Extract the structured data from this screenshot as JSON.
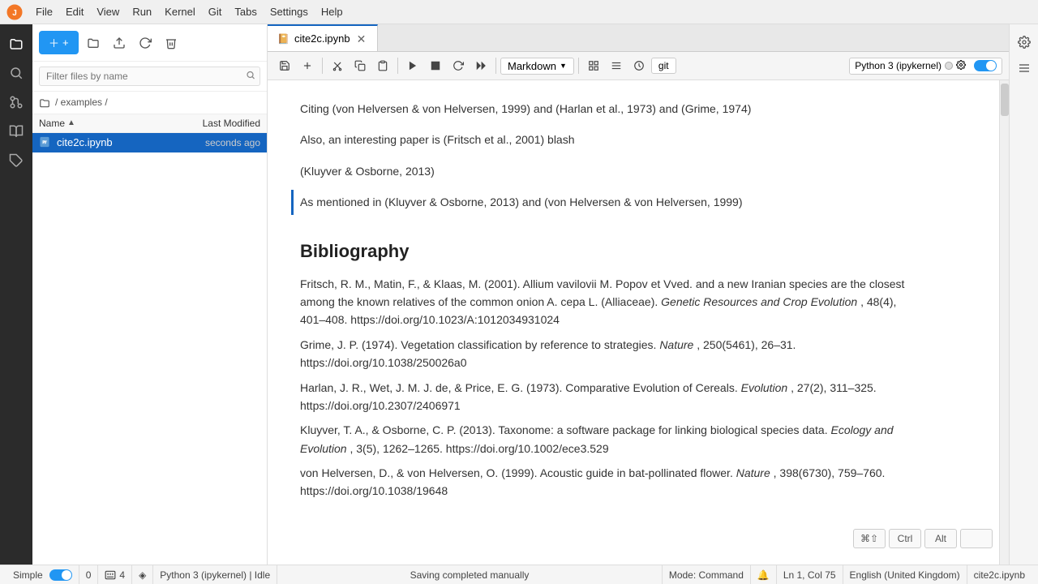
{
  "menu": {
    "items": [
      "File",
      "Edit",
      "View",
      "Run",
      "Kernel",
      "Git",
      "Tabs",
      "Settings",
      "Help"
    ]
  },
  "left_sidebar": {
    "icons": [
      "folder",
      "search",
      "git",
      "puzzle",
      "book"
    ]
  },
  "file_panel": {
    "new_button": "+",
    "toolbar_icons": [
      "folder-open",
      "upload",
      "refresh",
      "clear"
    ],
    "search_placeholder": "Filter files by name",
    "breadcrumb": "/ examples /",
    "columns": {
      "name": "Name",
      "sort_arrow": "▲",
      "modified": "Last Modified"
    },
    "files": [
      {
        "name": "cite2c.ipynb",
        "icon": "📄",
        "modified": "seconds ago",
        "selected": true
      }
    ]
  },
  "tab_bar": {
    "tabs": [
      {
        "label": "cite2c.ipynb",
        "active": true
      }
    ]
  },
  "notebook_toolbar": {
    "buttons": [
      "save",
      "add",
      "cut",
      "copy",
      "paste",
      "run",
      "stop",
      "restart",
      "fast-forward"
    ],
    "cell_type": "Markdown",
    "git_btn": "git",
    "kernel_label": "Python 3 (ipykernel)"
  },
  "notebook_content": {
    "cells": [
      {
        "type": "text",
        "content": "Citing (von Helversen & von Helversen, 1999) and (Harlan et al., 1973) and (Grime, 1974)"
      },
      {
        "type": "text",
        "content": "Also, an interesting paper is (Fritsch et al., 2001) blash"
      },
      {
        "type": "text",
        "content": "(Kluyver & Osborne, 2013)"
      },
      {
        "type": "text",
        "content": "As mentioned in (Kluyver & Osborne, 2013) and (von Helversen & von Helversen, 1999)"
      }
    ],
    "bibliography": {
      "title": "Bibliography",
      "entries": [
        {
          "text_plain": "Fritsch, R. M., Matin, F., & Klaas, M. (2001). Allium vavilovii M. Popov et Vved. and a new Iranian species are the closest among the known relatives of the common onion A. cepa L. (Alliaceae).",
          "italic": "Genetic Resources and Crop Evolution",
          "rest": ", 48(4), 401–408. https://doi.org/10.1023/A:1012034931024"
        },
        {
          "text_plain": "Grime, J. P. (1974). Vegetation classification by reference to strategies.",
          "italic": "Nature",
          "rest": ", 250(5461), 26–31. https://doi.org/10.1038/250026a0"
        },
        {
          "text_plain": "Harlan, J. R., Wet, J. M. J. de, & Price, E. G. (1973). Comparative Evolution of Cereals.",
          "italic": "Evolution",
          "rest": ", 27(2), 311–325. https://doi.org/10.2307/2406971"
        },
        {
          "text_plain": "Kluyver, T. A., & Osborne, C. P. (2013). Taxonome: a software package for linking biological species data.",
          "italic": "Ecology and Evolution",
          "rest": ", 3(5), 1262–1265. https://doi.org/10.1002/ece3.529"
        },
        {
          "text_plain": "von Helversen, D., & von Helversen, O. (1999). Acoustic guide in bat-pollinated flower.",
          "italic": "Nature",
          "rest": ", 398(6730), 759–760. https://doi.org/10.1038/19648"
        }
      ]
    }
  },
  "right_sidebar_icons": [
    "gear",
    "list"
  ],
  "status_bar": {
    "simple_label": "Simple",
    "toggle_on": true,
    "zero": "0",
    "shortcut": "4",
    "share_icon": "◈",
    "kernel_status": "Python 3 (ipykernel) | Idle",
    "saving": "Saving completed manually",
    "mode": "Mode: Command",
    "bell_icon": "🔔",
    "position": "Ln 1, Col 75",
    "language": "English (United Kingdom)",
    "filename": "cite2c.ipynb"
  }
}
